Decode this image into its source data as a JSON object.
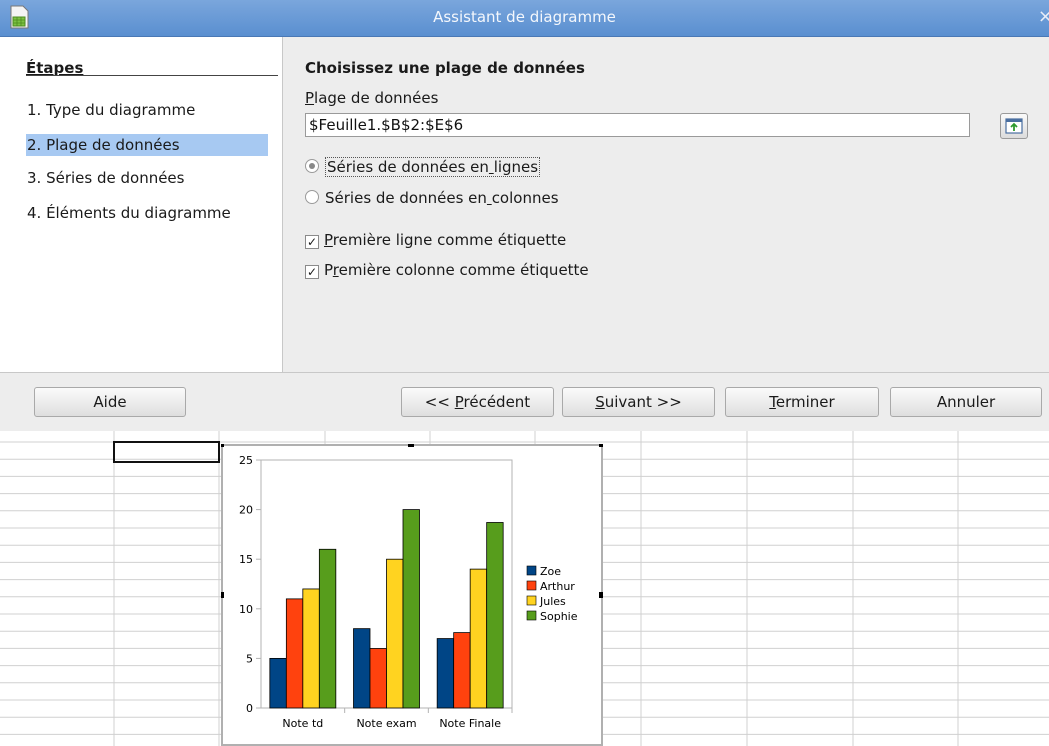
{
  "window": {
    "title": "Assistant de diagramme",
    "close_symbol": "×"
  },
  "steps": {
    "heading": "Étapes",
    "items": [
      {
        "label": "1. Type du diagramme",
        "selected": false
      },
      {
        "label": "2. Plage de données",
        "selected": true
      },
      {
        "label": "3. Séries de données",
        "selected": false
      },
      {
        "label": "4. Éléments du diagramme",
        "selected": false
      }
    ]
  },
  "content": {
    "heading": "Choisissez une plage de données",
    "range_label": "Plage de données",
    "range_value": "$Feuille1.$B$2:$E$6",
    "radio_rows": "Séries de données en lignes",
    "radio_columns": "Séries de données en colonnes",
    "selected_series_orientation": "lignes",
    "check_first_row": "Première ligne comme étiquette",
    "check_first_row_checked": true,
    "check_first_col": "Première colonne comme étiquette",
    "check_first_col_checked": true,
    "range_button_icon": "shrink-range-icon"
  },
  "buttons": {
    "help": "Aide",
    "previous": "<< Précédent",
    "next": "Suivant >>",
    "finish": "Terminer",
    "cancel": "Annuler"
  },
  "chart_data": {
    "type": "bar",
    "categories": [
      "Note td",
      "Note exam",
      "Note Finale"
    ],
    "series": [
      {
        "name": "Zoe",
        "color": "#004586",
        "values": [
          5,
          8,
          7
        ]
      },
      {
        "name": "Arthur",
        "color": "#ff420e",
        "values": [
          11,
          6,
          7.6
        ]
      },
      {
        "name": "Jules",
        "color": "#ffd320",
        "values": [
          12,
          15,
          14
        ]
      },
      {
        "name": "Sophie",
        "color": "#579d1c",
        "values": [
          16,
          20,
          18.7
        ]
      }
    ],
    "ylim": [
      0,
      25
    ],
    "yticks": [
      0,
      5,
      10,
      15,
      20,
      25
    ],
    "legend": "right",
    "grid": false
  }
}
